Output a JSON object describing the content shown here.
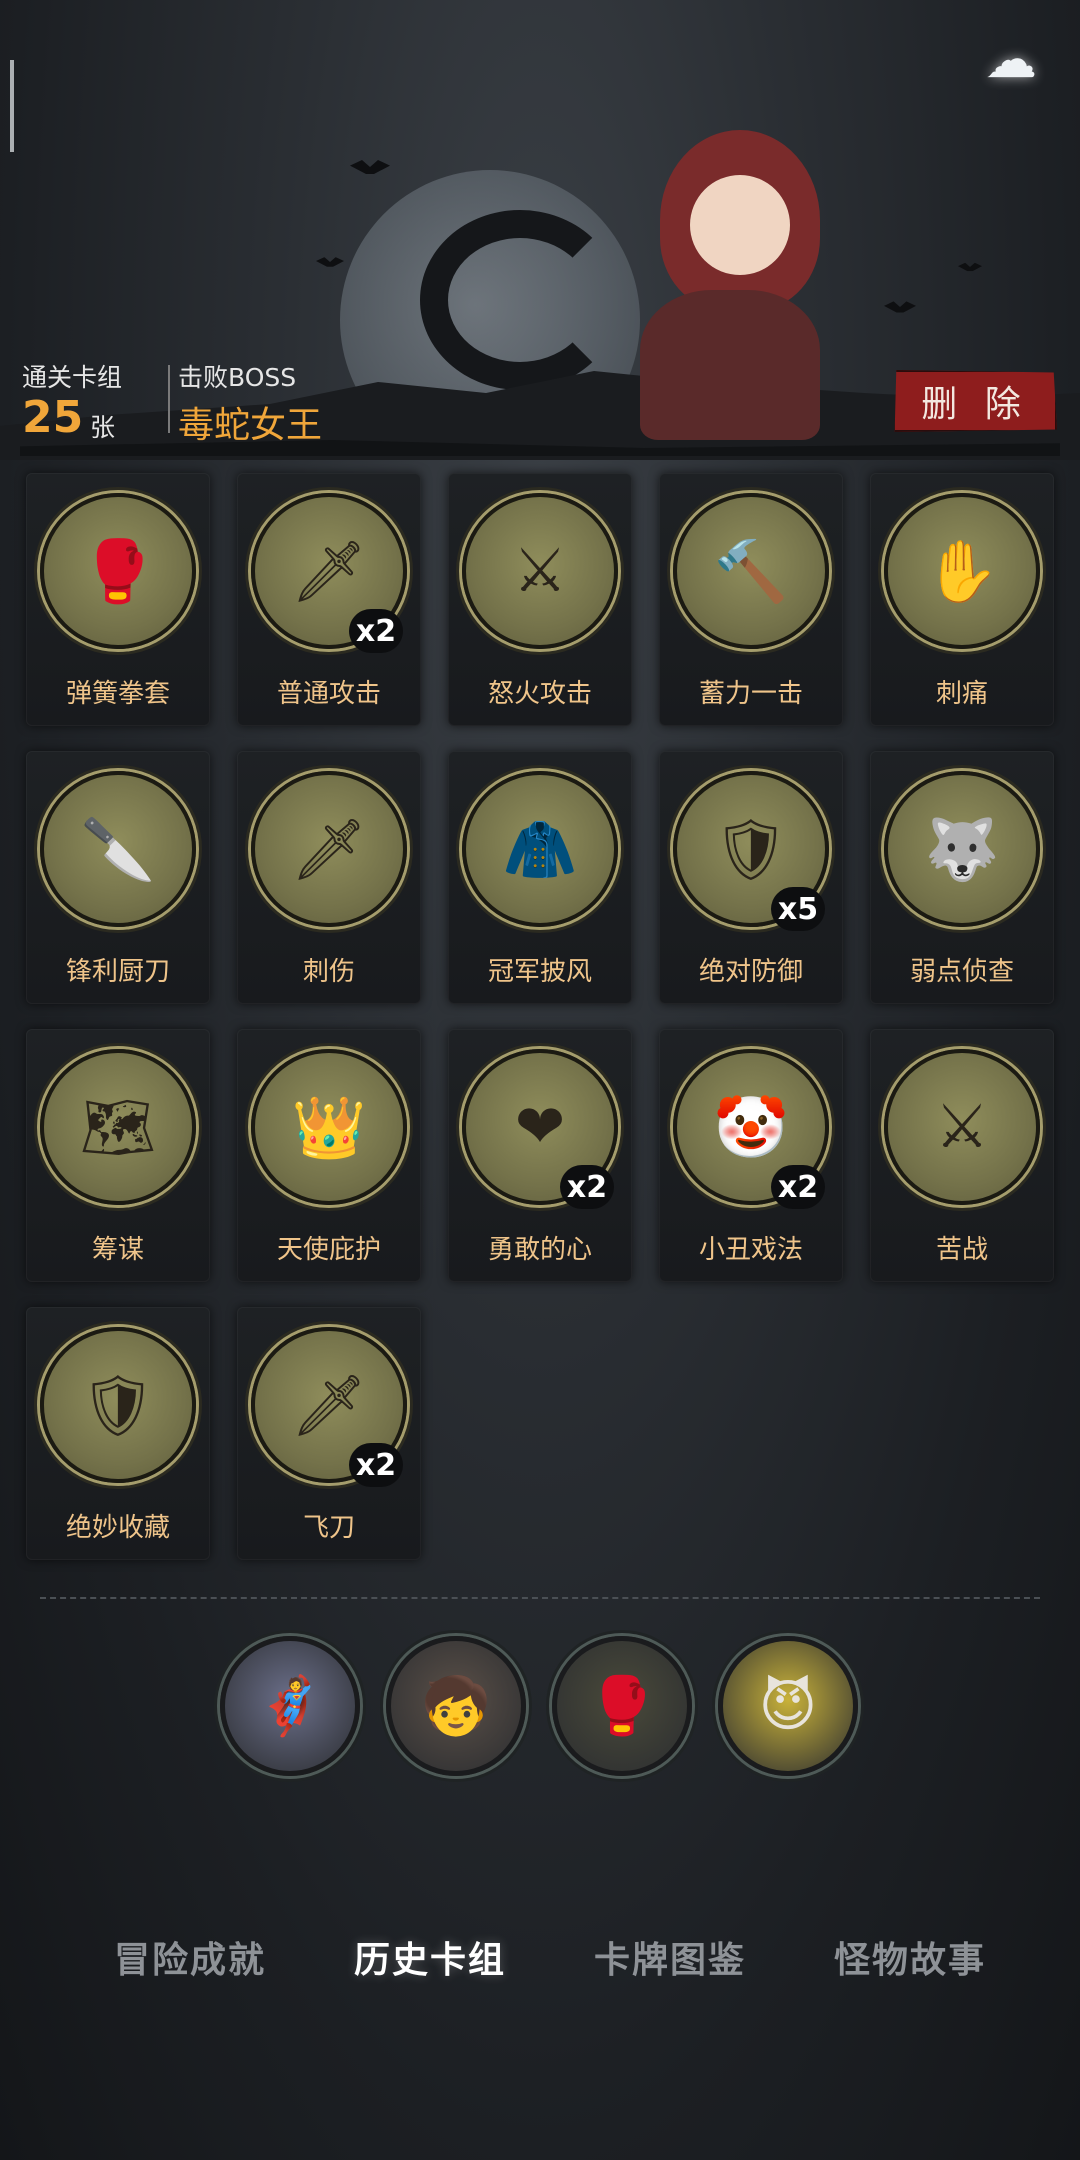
{
  "header": {
    "back_icon": "ghost-back-icon",
    "cleared_deck_label": "通关卡组",
    "card_count": "25",
    "card_unit": "张",
    "defeated_boss_label": "击败BOSS",
    "boss_name": "毒蛇女王",
    "delete_label": "删 除"
  },
  "cards": [
    {
      "name": "弹簧拳套",
      "icon": "spring-glove-icon",
      "glyph": "🥊",
      "count": ""
    },
    {
      "name": "普通攻击",
      "icon": "sword-icon",
      "glyph": "🗡",
      "count": "x2"
    },
    {
      "name": "怒火攻击",
      "icon": "rage-attack-icon",
      "glyph": "⚔",
      "count": ""
    },
    {
      "name": "蓄力一击",
      "icon": "hammer-icon",
      "glyph": "🔨",
      "count": ""
    },
    {
      "name": "刺痛",
      "icon": "sting-icon",
      "glyph": "✋",
      "count": ""
    },
    {
      "name": "锋利厨刀",
      "icon": "cleaver-icon",
      "glyph": "🔪",
      "count": ""
    },
    {
      "name": "刺伤",
      "icon": "dagger-icon",
      "glyph": "🗡",
      "count": ""
    },
    {
      "name": "冠军披风",
      "icon": "cape-icon",
      "glyph": "🧥",
      "count": ""
    },
    {
      "name": "绝对防御",
      "icon": "shield-warrior-icon",
      "glyph": "🛡",
      "count": "x5"
    },
    {
      "name": "弱点侦查",
      "icon": "wolf-icon",
      "glyph": "🐺",
      "count": ""
    },
    {
      "name": "筹谋",
      "icon": "map-icon",
      "glyph": "🗺",
      "count": ""
    },
    {
      "name": "天使庇护",
      "icon": "angel-wings-icon",
      "glyph": "👑",
      "count": ""
    },
    {
      "name": "勇敢的心",
      "icon": "brave-heart-icon",
      "glyph": "❤",
      "count": "x2"
    },
    {
      "name": "小丑戏法",
      "icon": "clown-icon",
      "glyph": "🤡",
      "count": "x2"
    },
    {
      "name": "苦战",
      "icon": "struggle-icon",
      "glyph": "⚔",
      "count": ""
    },
    {
      "name": "绝妙收藏",
      "icon": "collection-icon",
      "glyph": "🛡",
      "count": ""
    },
    {
      "name": "飞刀",
      "icon": "throwing-knives-icon",
      "glyph": "🗡",
      "count": "x2"
    }
  ],
  "relics": [
    {
      "icon": "hero-cliff-relic-icon",
      "glyph": "🦸",
      "bg": "#6b6f8a"
    },
    {
      "icon": "girl-window-relic-icon",
      "glyph": "🧒",
      "bg": "#5b5048"
    },
    {
      "icon": "boxing-ring-relic-icon",
      "glyph": "🥊",
      "bg": "#4a4a3a"
    },
    {
      "icon": "red-devil-relic-icon",
      "glyph": "😈",
      "bg": "#c9b23a"
    }
  ],
  "tabs": [
    {
      "label": "冒险成就",
      "active": false
    },
    {
      "label": "历史卡组",
      "active": true
    },
    {
      "label": "卡牌图鉴",
      "active": false
    },
    {
      "label": "怪物故事",
      "active": false
    }
  ]
}
